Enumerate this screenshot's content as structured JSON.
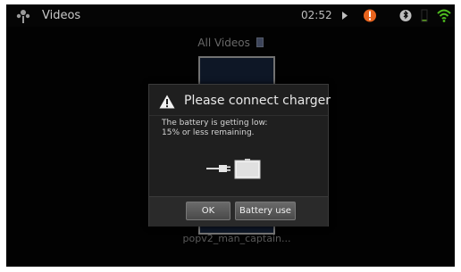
{
  "statusbar": {
    "app_title": "Videos",
    "clock": "02:52",
    "icons": [
      "app-launcher-icon",
      "play-icon",
      "battery-alert-icon",
      "bluetooth-icon",
      "battery-low-icon",
      "wifi-icon"
    ],
    "colors": {
      "alert": "#e8641e",
      "wifi": "#4fbf1f",
      "battery": "#5aa01f"
    }
  },
  "main": {
    "header_label": "All Videos",
    "thumbnail_caption": "popv2_man_captain..."
  },
  "dialog": {
    "title": "Please connect charger",
    "message_line1": "The battery is getting low:",
    "message_line2": "15% or less remaining.",
    "ok_label": "OK",
    "battery_use_label": "Battery use"
  }
}
